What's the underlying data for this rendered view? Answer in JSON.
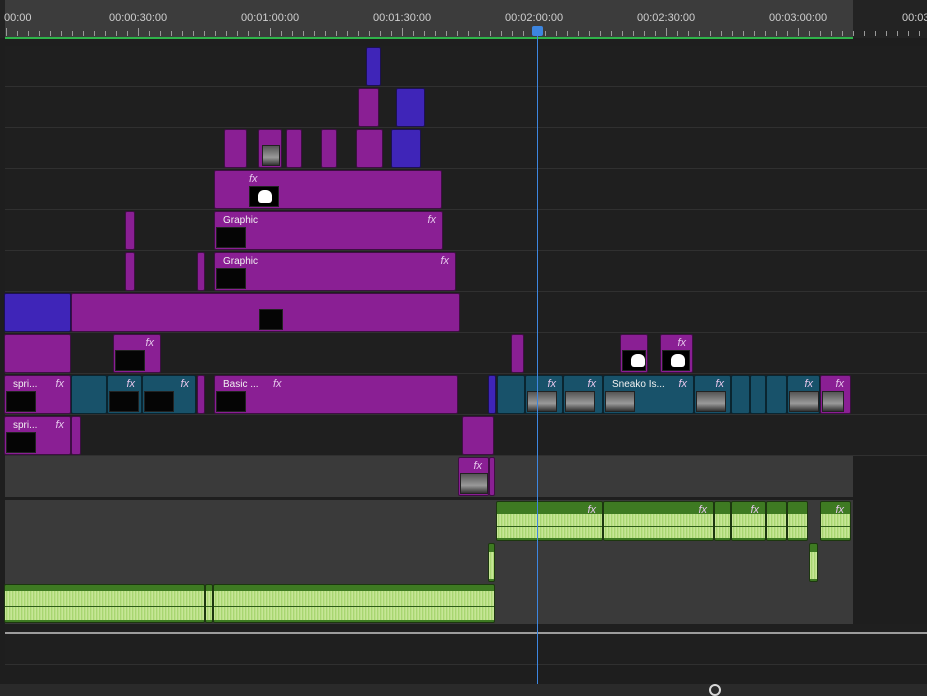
{
  "timeline": {
    "ruler": {
      "timecodes": [
        "00:00",
        "00:00:30:00",
        "00:01:00:00",
        "00:01:30:00",
        "00:02:00:00",
        "00:02:30:00",
        "00:03:00:00",
        "00:03"
      ]
    },
    "clip_labels": {
      "graphic": "Graphic",
      "spri": "spri...",
      "basic": "Basic ...",
      "sneako": "Sneako Is...",
      "fx": "fx"
    },
    "colors": {
      "video_clip": "#8a1f94",
      "nested_clip": "#3f25b8",
      "adjust_clip": "#18526a",
      "audio_clip": "#3e7a22",
      "playhead": "#3d86e0",
      "work_area": "#2fb34a"
    }
  }
}
